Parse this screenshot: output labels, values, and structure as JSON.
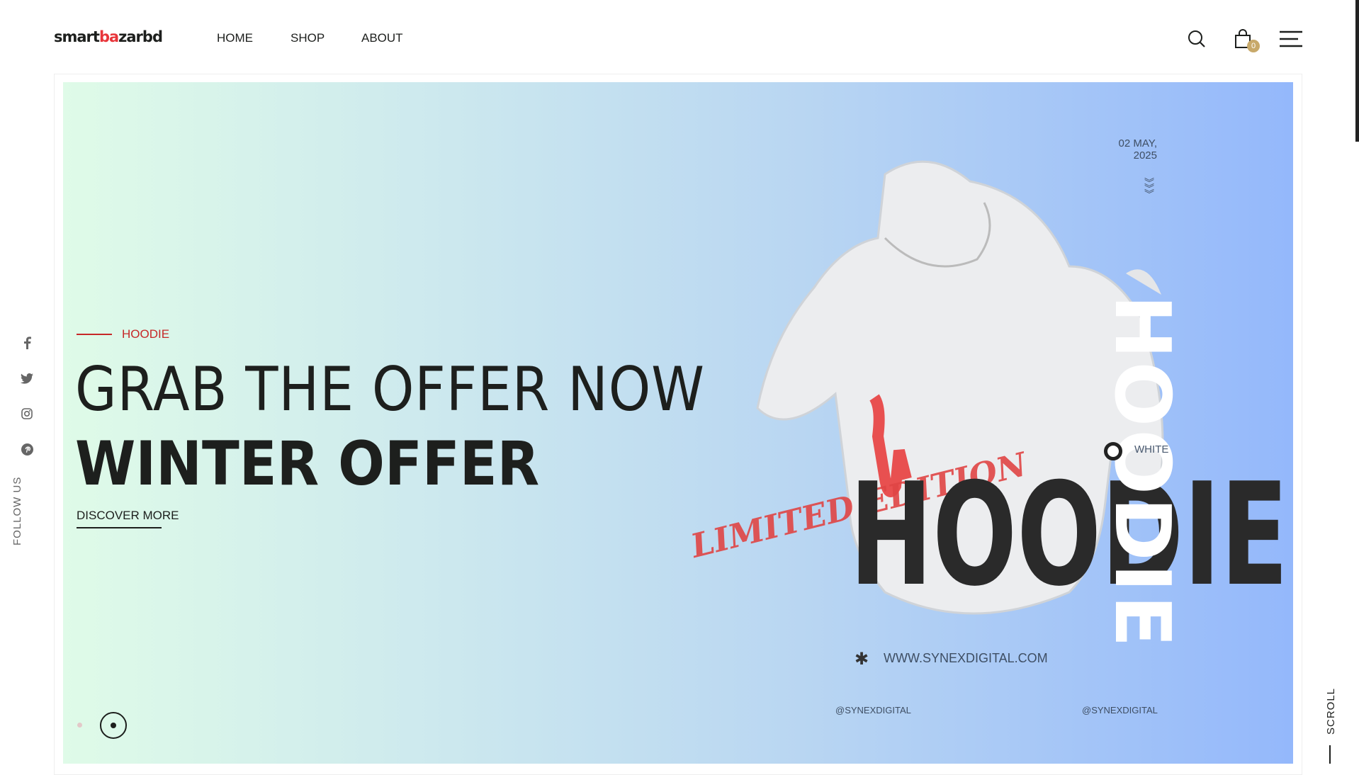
{
  "header": {
    "logo": {
      "part1": "smart",
      "part2": "ba",
      "part3": "zarbd"
    },
    "nav": [
      {
        "label": "HOME"
      },
      {
        "label": "SHOP"
      },
      {
        "label": "ABOUT"
      }
    ],
    "cart_count": "0",
    "icons": [
      "search-icon",
      "shopping-bag-icon",
      "menu-icon"
    ]
  },
  "social": {
    "icons": [
      "facebook-icon",
      "twitter-icon",
      "instagram-icon",
      "pinterest-icon"
    ],
    "label": "FOLLOW US"
  },
  "hero": {
    "subtitle": "HOODIE",
    "title_line1": "GRAB THE OFFER NOW",
    "title_line2": "WINTER OFFER",
    "cta": "DISCOVER MORE",
    "image": {
      "date": "02 MAY,",
      "year": "2025",
      "color_label": "WHITE",
      "big_word": "HOODIE",
      "limited": "LIMITED EDITION",
      "url": "WWW.SYNEXDIGITAL.COM",
      "handle_left": "@SYNEXDIGITAL",
      "handle_right": "@SYNEXDIGITAL"
    },
    "slide_count": 2,
    "active_slide": 2
  },
  "scroll_label": "SCROLL",
  "colors": {
    "accent": "#c62828",
    "badge": "#c8a96a",
    "text": "#1d1f1d"
  }
}
